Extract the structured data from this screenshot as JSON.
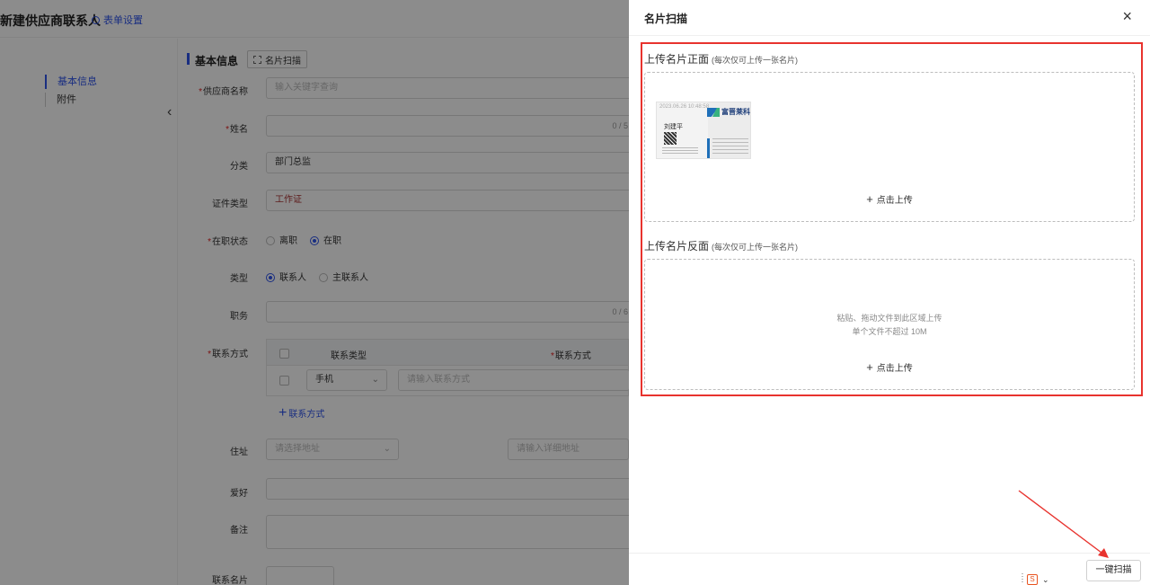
{
  "header": {
    "page_title": "新建供应商联系人",
    "form_settings": "表单设置"
  },
  "left_nav": {
    "items": [
      {
        "label": "基本信息",
        "active": true
      },
      {
        "label": "附件",
        "active": false
      }
    ]
  },
  "form": {
    "section_title": "基本信息",
    "scan_button": "名片扫描",
    "supplier": {
      "label": "供应商名称",
      "placeholder": "输入关键字查询"
    },
    "name": {
      "label": "姓名",
      "counter": "0 / 5"
    },
    "category": {
      "label": "分类",
      "value": "部门总监"
    },
    "id_type": {
      "label": "证件类型",
      "value": "工作证"
    },
    "status": {
      "label": "在职状态",
      "options": [
        "离职",
        "在职"
      ],
      "selected": "在职"
    },
    "type": {
      "label": "类型",
      "options": [
        "联系人",
        "主联系人"
      ],
      "selected": "联系人"
    },
    "position": {
      "label": "职务",
      "counter": "0 / 6"
    },
    "contact": {
      "label": "联系方式",
      "col_type": "联系类型",
      "col_method": "联系方式",
      "row_type": "手机",
      "row_placeholder": "请输入联系方式",
      "add_label": "联系方式"
    },
    "address": {
      "label": "住址",
      "select_placeholder": "请选择地址",
      "detail_placeholder": "请输入详细地址"
    },
    "hobby": {
      "label": "爱好"
    },
    "remark": {
      "label": "备注"
    },
    "card": {
      "label": "联系名片"
    }
  },
  "drawer": {
    "title": "名片扫描",
    "front": {
      "label": "上传名片正面",
      "hint": "(每次仅可上传一张名片)",
      "upload": "点击上传",
      "card": {
        "timestamp": "2023.06.26  10:48:58",
        "company": "富晋莱科",
        "name": "刘建平"
      }
    },
    "back": {
      "label": "上传名片反面",
      "hint": "(每次仅可上传一张名片)",
      "drop_hint_1": "粘贴、拖动文件到此区域上传",
      "drop_hint_2": "单个文件不超过 10M",
      "upload": "点击上传"
    },
    "scan_button": "一键扫描"
  },
  "colors": {
    "accent": "#2f54eb",
    "required": "#e02020",
    "highlight": "#e8332e",
    "arrow": "#e8332e"
  }
}
